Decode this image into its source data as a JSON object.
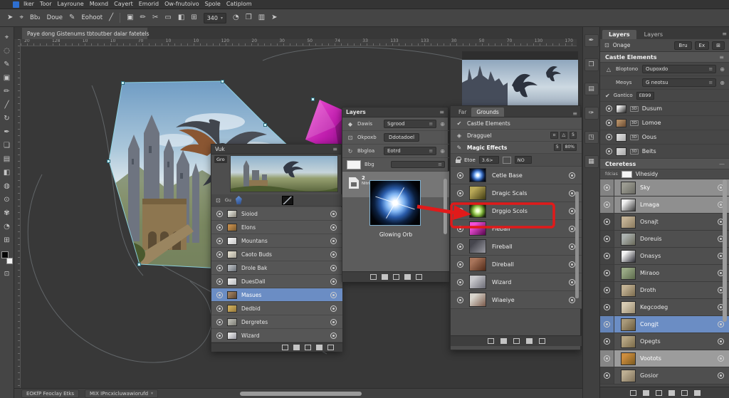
{
  "colors": {
    "accent_blue": "#6b8dc4",
    "annotation_red": "#e11a1a",
    "handle_cyan": "#c9f2f8",
    "app_icon_blue": "#2e6fd0"
  },
  "menubar": {
    "items": [
      "Iker",
      "Toor",
      "Layroune",
      "Moxnd",
      "Cayert",
      "Emorid",
      "Ow-fnutoivo",
      "Spole",
      "Catiplom"
    ]
  },
  "optionsbar": {
    "items": [
      {
        "type": "icon",
        "name": "pointer-tool-icon",
        "t": "➤"
      },
      {
        "type": "icon",
        "name": "eyedropper-tool-icon",
        "t": "⌖"
      },
      {
        "type": "label",
        "name": "type-tool-label",
        "t": "Bb₂"
      },
      {
        "type": "label",
        "name": "draw-mode-label",
        "t": "Doue"
      },
      {
        "type": "icon",
        "name": "pencil-icon",
        "t": "✎"
      },
      {
        "type": "label",
        "name": "stroke-label",
        "t": "Eohoot"
      },
      {
        "type": "icon",
        "name": "line-tool-icon",
        "t": "╱"
      },
      {
        "type": "sep"
      },
      {
        "type": "icon",
        "name": "artboard-icon",
        "t": "▣"
      },
      {
        "type": "icon",
        "name": "pen-icon",
        "t": "✏"
      },
      {
        "type": "icon",
        "name": "scissors-icon",
        "t": "✂"
      },
      {
        "type": "icon",
        "name": "marquee-icon",
        "t": "▭"
      },
      {
        "type": "icon",
        "name": "transform-icon",
        "t": "◧"
      },
      {
        "type": "icon",
        "name": "align-icon",
        "t": "⊞"
      },
      {
        "type": "dropdown",
        "name": "zoom-level-select",
        "t": "340"
      },
      {
        "type": "icon",
        "name": "history-icon",
        "t": "◔"
      },
      {
        "type": "icon",
        "name": "libraries-icon",
        "t": "❐"
      },
      {
        "type": "icon",
        "name": "workspace-icon",
        "t": "▥"
      },
      {
        "type": "icon",
        "name": "cursor-icon",
        "t": "➤"
      }
    ]
  },
  "doc_tab": {
    "label": "Paye dong Gistenums tbtoutber dalar fatetels"
  },
  "ruler": {
    "ticks": [
      "20",
      "128",
      "10",
      "10",
      "70",
      "10",
      "10",
      "120",
      "20",
      "30",
      "50",
      "74",
      "33",
      "133",
      "133",
      "30",
      "50",
      "70",
      "130",
      "170"
    ]
  },
  "left_toolbar": {
    "tools": [
      {
        "name": "move-tool-icon",
        "g": "⌖"
      },
      {
        "name": "lasso-tool-icon",
        "g": "◌"
      },
      {
        "name": "pen-tool-icon",
        "g": "✎"
      },
      {
        "name": "shape-tool-icon",
        "g": "▣"
      },
      {
        "name": "pencil-tool-icon",
        "g": "✏"
      },
      {
        "name": "line-tool-icon",
        "g": "╱"
      },
      {
        "name": "rotate-tool-icon",
        "g": "↻"
      },
      {
        "name": "ink-tool-icon",
        "g": "✒"
      },
      {
        "name": "crop-tool-icon",
        "g": "❏"
      },
      {
        "name": "artboard-tool-icon",
        "g": "▤"
      },
      {
        "name": "gradient-tool-icon",
        "g": "◧"
      },
      {
        "name": "fill-tool-icon",
        "g": "◍"
      },
      {
        "name": "target-tool-icon",
        "g": "⊙"
      },
      {
        "name": "blur-tool-icon",
        "g": "✾"
      },
      {
        "name": "dodge-tool-icon",
        "g": "◔"
      },
      {
        "name": "grid-tool-icon",
        "g": "⊞"
      }
    ]
  },
  "panel_castle": {
    "title": "Vuk",
    "tag": "Gro",
    "rows": [
      {
        "name": "Sioiod",
        "thumb": [
          "#d8d8d0",
          "#888478"
        ]
      },
      {
        "name": "Elons",
        "thumb": [
          "#c08a4a",
          "#7a5a2e"
        ]
      },
      {
        "name": "Mountans",
        "thumb": [
          "#ececec",
          "#c4c4c4"
        ]
      },
      {
        "name": "Caoto Buds",
        "thumb": [
          "#ddd8c8",
          "#a8a498"
        ]
      },
      {
        "name": "Drole Bak",
        "thumb": [
          "#b0b4b8",
          "#6a7078"
        ]
      },
      {
        "name": "DuesDall",
        "thumb": [
          "#e4e4e4",
          "#b8bcc0"
        ]
      },
      {
        "name": "Masues",
        "thumb": [
          "#9a7a5a",
          "#5a4430"
        ],
        "state": "selected"
      },
      {
        "name": "Dedbid",
        "thumb": [
          "#c8a85a",
          "#96793a"
        ]
      },
      {
        "name": "Dergretes",
        "thumb": [
          "#b4b4ac",
          "#7c7c74"
        ]
      },
      {
        "name": "Wizard",
        "thumb": [
          "#e0e0e0",
          "#9a9aa4"
        ]
      }
    ],
    "footer_icons": [
      "mask-icon",
      "fx-icon",
      "group-icon",
      "adjustment-icon",
      "new-layer-icon"
    ]
  },
  "panel_layers": {
    "title": "Layers",
    "props": [
      {
        "g": "◆",
        "label": "Dawis",
        "type": "dropdown",
        "value": "Sgrood"
      },
      {
        "g": "⊡",
        "label": "Okpoxb",
        "type": "button",
        "value": "Ddotadoel"
      },
      {
        "g": "↻",
        "label": "Bbgloa",
        "type": "dropdown",
        "value": "Eotrd"
      },
      {
        "g": "",
        "label": "Bbg",
        "type": "slider",
        "value": ""
      }
    ],
    "doc_badge": "2",
    "doc_name": "Nitri",
    "orb_caption": "Glowing Orb",
    "footer_icons": [
      "mask-icon",
      "fx-icon",
      "group-icon",
      "adjustment-icon",
      "new-layer-icon"
    ]
  },
  "panel_grounds": {
    "tabs": [
      "Far",
      "Grounds"
    ],
    "groups": [
      {
        "g": "✔",
        "label": "Castle Elements",
        "badges": []
      },
      {
        "g": "◈",
        "label": "Dragguel",
        "badges": [
          "▫",
          "△",
          "5"
        ]
      },
      {
        "g": "✎",
        "label": "Magic Effects",
        "badges": [
          "5",
          "80%"
        ],
        "strong": true
      }
    ],
    "lock_row": {
      "label": "Etoe",
      "field": "3.6>",
      "swatch": "#0a0a0a",
      "field2": "NO"
    },
    "rows": [
      {
        "name": "Cetle Base",
        "thumb": "orb-blue"
      },
      {
        "name": "Dragic Scals",
        "thumb": [
          "#b8a858",
          "#3f3a12"
        ]
      },
      {
        "name": "Drggio Scols",
        "thumb": "orb-green",
        "annotated": true
      },
      {
        "name": "Fieball",
        "thumb": [
          "#f04fd8",
          "#52054a"
        ]
      },
      {
        "name": "Fireball",
        "thumb": [
          "#46464e",
          "#9a9aa2"
        ]
      },
      {
        "name": "Direball",
        "thumb": [
          "#a8745a",
          "#502a18"
        ]
      },
      {
        "name": "Wizard",
        "thumb": [
          "#c8c8cc",
          "#6a6a74"
        ]
      },
      {
        "name": "Wiaeiye",
        "thumb": [
          "#d8d4cc",
          "#7a5a4a"
        ]
      }
    ],
    "footer_icons": [
      "mask-icon",
      "fx-icon",
      "group-icon",
      "adjustment-icon",
      "new-layer-icon"
    ]
  },
  "annotation": {
    "color": "#e11a1a",
    "target": "Drggio Scols"
  },
  "dock": {
    "icons": [
      {
        "name": "brushes-panel-icon",
        "g": "✒"
      },
      {
        "name": "layer-comps-panel-icon",
        "g": "❒"
      },
      {
        "name": "channels-panel-icon",
        "g": "▤"
      },
      {
        "name": "paths-panel-icon",
        "g": "✑"
      },
      {
        "name": "adjustments-panel-icon",
        "g": "◳"
      },
      {
        "name": "histogram-panel-icon",
        "g": "▦"
      }
    ]
  },
  "right_panel": {
    "tabs": [
      "Layers",
      "Layers"
    ],
    "toolbar": {
      "label": "Onage",
      "buttons": [
        "Bru",
        "Ex",
        "⊞"
      ]
    },
    "section1": "Castle Elements",
    "props": [
      {
        "g": "△",
        "label": "Bloptono",
        "value": "Oupoxdo"
      },
      {
        "g": "",
        "label": "Meoys",
        "value": "G neotsu"
      }
    ],
    "lock_label": "Gantico",
    "lock_value": "EB99",
    "link_badge": "3D",
    "rows_small": [
      {
        "name": "Dusum",
        "thumb": [
          "#e8e8e8",
          "#2a2a2a"
        ]
      },
      {
        "name": "Lomoe",
        "thumb": [
          "#b08a62",
          "#6a4a30"
        ]
      },
      {
        "name": "Oous",
        "thumb": [
          "#d8d8d8",
          "#b0b0b0"
        ]
      },
      {
        "name": "Beits",
        "thumb": [
          "#d0d0d0",
          "#a8a8a8"
        ]
      }
    ],
    "section2": "Cteretess",
    "sub_label": "fdcias",
    "sub_value": "Vihesidy",
    "rows_big": [
      {
        "name": "Sky",
        "thumb": [
          "#9a9a90",
          "#6a6a62"
        ],
        "state": "lighter"
      },
      {
        "name": "Lmaga",
        "thumb": [
          "#f0f0f0",
          "#3a3a3a"
        ],
        "state": "lighter"
      },
      {
        "name": "Osnajt",
        "thumb": [
          "#c2b194",
          "#8a7a5e"
        ]
      },
      {
        "name": "Doreuis",
        "thumb": [
          "#aab0ae",
          "#6a6a5a"
        ]
      },
      {
        "name": "Onasys",
        "thumb": [
          "#f2f2f2",
          "#2e2e36"
        ]
      },
      {
        "name": "Miraoo",
        "thumb": [
          "#98a884",
          "#5c6a4c"
        ]
      },
      {
        "name": "Droth",
        "thumb": [
          "#c0b092",
          "#7c6c4e"
        ]
      },
      {
        "name": "Kegcodeg",
        "thumb": [
          "#d6cab2",
          "#9a8c70"
        ]
      },
      {
        "name": "Congjt",
        "thumb": [
          "#a8997a",
          "#6a5a3c"
        ],
        "state": "selected"
      },
      {
        "name": "Opegts",
        "thumb": [
          "#b4a482",
          "#7a6a48"
        ]
      },
      {
        "name": "Vootots",
        "thumb": [
          "#cd8d3d",
          "#7a5a20"
        ],
        "state": "light2"
      },
      {
        "name": "Gosior",
        "thumb": [
          "#bcae92",
          "#80725a"
        ]
      }
    ],
    "footer_icons": [
      "fx-icon",
      "mask-icon",
      "adjustment-icon",
      "group-icon",
      "new-layer-icon",
      "delete-icon"
    ]
  },
  "statusbar": {
    "left": "EOKfP Feoclay Etks",
    "mid": "MIX IPncxicluwawiorufd",
    "progress_pct": 100
  }
}
